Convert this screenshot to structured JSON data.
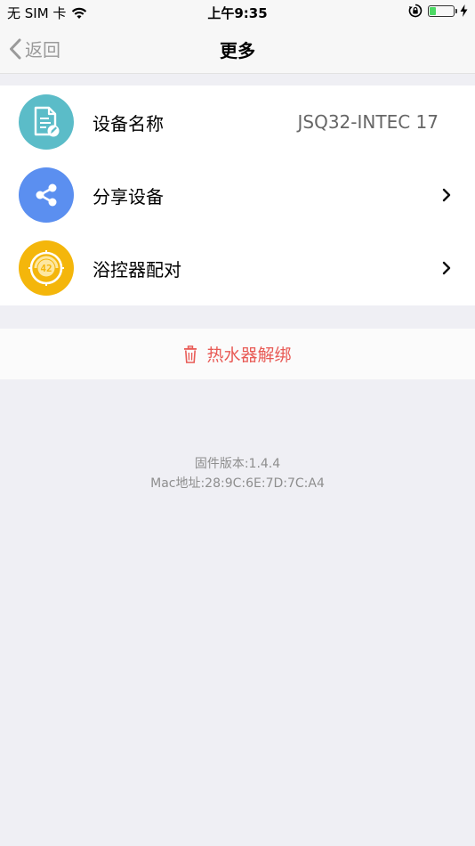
{
  "status_bar": {
    "carrier": "无 SIM 卡",
    "time": "上午9:35",
    "battery_level": 0.25,
    "icons": [
      "wifi-icon",
      "orientation-lock-icon",
      "battery-icon",
      "charging-icon"
    ]
  },
  "nav": {
    "back_label": "返回",
    "title": "更多"
  },
  "rows": [
    {
      "label": "设备名称",
      "value": "JSQ32-INTEC 17",
      "icon": "document-edit-icon",
      "icon_color": "#5bbcc8"
    },
    {
      "label": "分享设备",
      "icon": "share-icon",
      "icon_color": "#5b8ff0"
    },
    {
      "label": "浴控器配对",
      "icon": "bath-controller-icon",
      "icon_color": "#f4b60b",
      "icon_number": "42"
    }
  ],
  "unbind": {
    "label": "热水器解绑",
    "color": "#e85a55"
  },
  "footer": {
    "firmware": "固件版本:1.4.4",
    "mac": "Mac地址:28:9C:6E:7D:7C:A4"
  }
}
